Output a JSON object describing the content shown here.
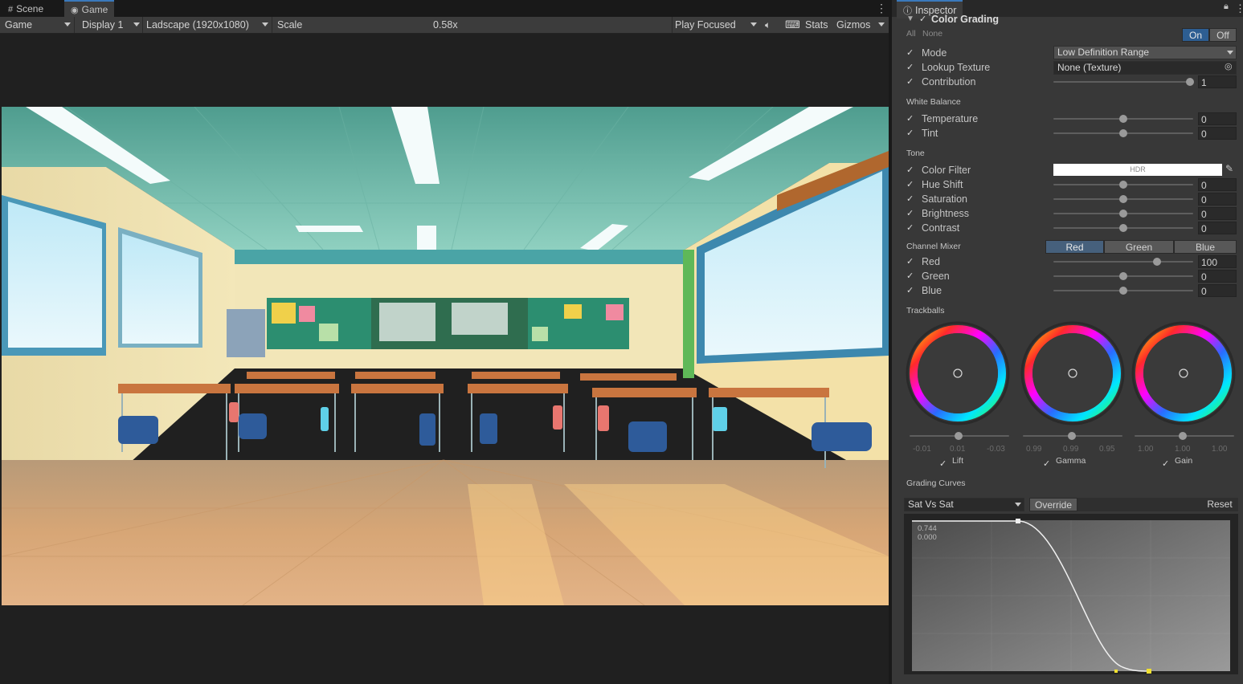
{
  "tabs": {
    "scene": "Scene",
    "game": "Game"
  },
  "toolbar": {
    "game_mode": "Game",
    "display": "Display 1",
    "resolution": "Ladscape (1920x1080)",
    "scale_label": "Scale",
    "scale_value": "0.58x",
    "play_mode": "Play Focused",
    "stats": "Stats",
    "gizmos": "Gizmos"
  },
  "inspector": {
    "title": "Inspector",
    "component": "Color Grading",
    "all": "All",
    "none": "None",
    "on": "On",
    "off": "Off",
    "mode": {
      "label": "Mode",
      "value": "Low Definition Range"
    },
    "lookup": {
      "label": "Lookup Texture",
      "value": "None (Texture)"
    },
    "contribution": {
      "label": "Contribution",
      "value": "1"
    },
    "white_balance": {
      "title": "White Balance",
      "temperature": {
        "label": "Temperature",
        "value": "0"
      },
      "tint": {
        "label": "Tint",
        "value": "0"
      }
    },
    "tone": {
      "title": "Tone",
      "color_filter": {
        "label": "Color Filter",
        "badge": "HDR"
      },
      "hue_shift": {
        "label": "Hue Shift",
        "value": "0"
      },
      "saturation": {
        "label": "Saturation",
        "value": "0"
      },
      "brightness": {
        "label": "Brightness",
        "value": "0"
      },
      "contrast": {
        "label": "Contrast",
        "value": "0"
      }
    },
    "channel_mixer": {
      "title": "Channel Mixer",
      "tabs": [
        "Red",
        "Green",
        "Blue"
      ],
      "red": {
        "label": "Red",
        "value": "100"
      },
      "green": {
        "label": "Green",
        "value": "0"
      },
      "blue": {
        "label": "Blue",
        "value": "0"
      }
    },
    "trackballs": {
      "title": "Trackballs",
      "lift": {
        "label": "Lift",
        "values": [
          "-0.01",
          "0.01",
          "-0.03"
        ]
      },
      "gamma": {
        "label": "Gamma",
        "values": [
          "0.99",
          "0.99",
          "0.95"
        ]
      },
      "gain": {
        "label": "Gain",
        "values": [
          "1.00",
          "1.00",
          "1.00"
        ]
      }
    },
    "grading_curves": {
      "title": "Grading Curves",
      "curve": "Sat Vs Sat",
      "override": "Override",
      "reset": "Reset",
      "readout_x": "0.744",
      "readout_y": "0.000"
    }
  },
  "colors": {
    "accent": "#3a79bb",
    "panel": "#383838",
    "toolbar": "#3c3c3c"
  },
  "icons": [
    "scene-grid-icon",
    "gamepad-icon",
    "kebab-menu-icon",
    "speaker-icon",
    "keyboard-icon",
    "info-icon",
    "lock-icon",
    "eyedropper-icon",
    "target-icon"
  ]
}
